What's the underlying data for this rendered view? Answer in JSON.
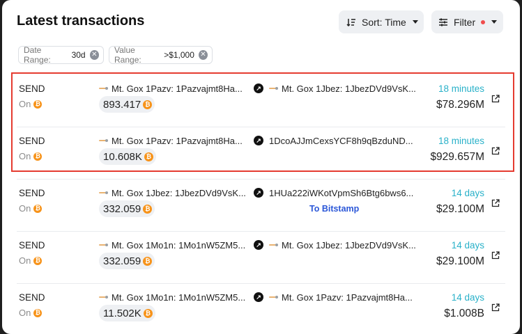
{
  "header": {
    "title": "Latest transactions",
    "sort_label": "Sort: Time",
    "filter_label": "Filter"
  },
  "filters": [
    {
      "label": "Date Range:",
      "value": "30d"
    },
    {
      "label": "Value Range:",
      "value": ">$1,000"
    }
  ],
  "transactions": [
    {
      "type": "SEND",
      "chain": "On",
      "from": "Mt. Gox 1Pazv: 1Pazvajmt8Ha...",
      "to": "Mt. Gox 1Jbez: 1JbezDVd9VsK...",
      "to_is_entity": true,
      "amount": "893.417",
      "time": "18 minutes",
      "usd": "$78.296M",
      "note": ""
    },
    {
      "type": "SEND",
      "chain": "On",
      "from": "Mt. Gox 1Pazv: 1Pazvajmt8Ha...",
      "to": "1DcoAJJmCexsYCF8h9qBzduND...",
      "to_is_entity": false,
      "amount": "10.608K",
      "time": "18 minutes",
      "usd": "$929.657M",
      "note": ""
    },
    {
      "type": "SEND",
      "chain": "On",
      "from": "Mt. Gox 1Jbez: 1JbezDVd9VsK...",
      "to": "1HUa222iWKotVpmSh6Btg6bws6...",
      "to_is_entity": false,
      "amount": "332.059",
      "time": "14 days",
      "usd": "$29.100M",
      "note": "To Bitstamp"
    },
    {
      "type": "SEND",
      "chain": "On",
      "from": "Mt. Gox 1Mo1n: 1Mo1nW5ZM5...",
      "to": "Mt. Gox 1Jbez: 1JbezDVd9VsK...",
      "to_is_entity": true,
      "amount": "332.059",
      "time": "14 days",
      "usd": "$29.100M",
      "note": ""
    },
    {
      "type": "SEND",
      "chain": "On",
      "from": "Mt. Gox 1Mo1n: 1Mo1nW5ZM5...",
      "to": "Mt. Gox 1Pazv: 1Pazvajmt8Ha...",
      "to_is_entity": true,
      "amount": "11.502K",
      "time": "14 days",
      "usd": "$1.008B",
      "note": ""
    }
  ],
  "icons": {
    "coin": "bitcoin-icon",
    "external": "external-link-icon",
    "arrow": "arrow-up-right-icon"
  },
  "colors": {
    "time": "#29b1c9",
    "note": "#2b57d8",
    "bitcoin": "#f7931a",
    "highlight": "#e53b30",
    "filter_dot": "#f04c4c"
  }
}
